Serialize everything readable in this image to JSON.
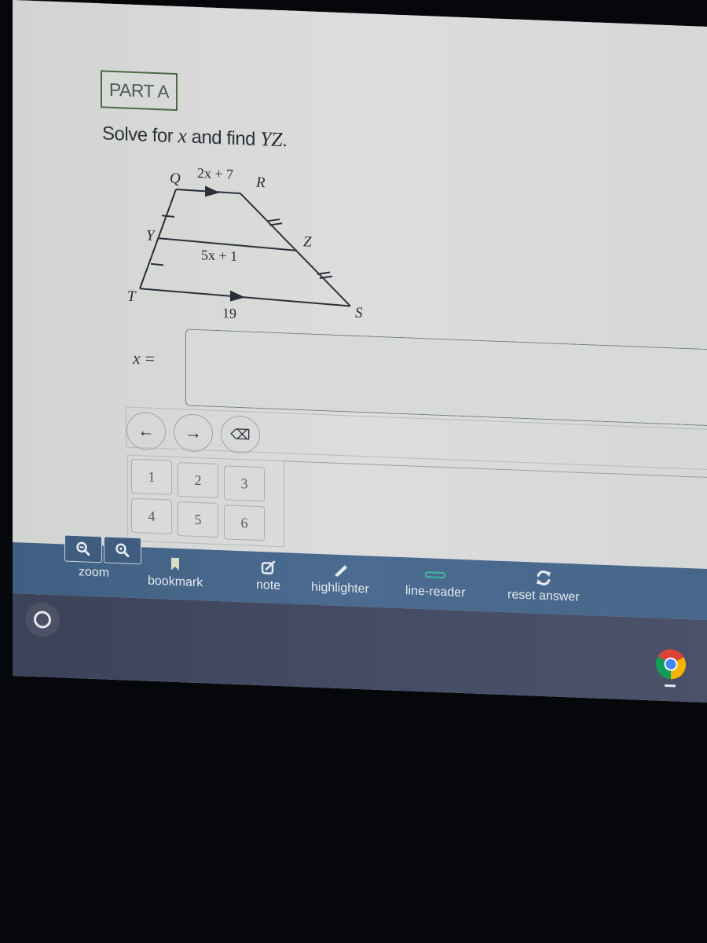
{
  "question": {
    "part_label": "PART A",
    "prompt_prefix": "Solve for ",
    "prompt_var": "x",
    "prompt_middle": " and find ",
    "prompt_segment": "YZ",
    "prompt_suffix": "."
  },
  "diagram": {
    "vertices": {
      "Q": "Q",
      "R": "R",
      "Y": "Y",
      "Z": "Z",
      "T": "T",
      "S": "S"
    },
    "top_base_label": "2x + 7",
    "midsegment_label": "5x + 1",
    "bottom_base_label": "19"
  },
  "answer": {
    "variable_label": "x",
    "equals": "=",
    "value": "",
    "placeholder": ""
  },
  "navigation": {
    "left_icon": "←",
    "right_icon": "→",
    "backspace_icon": "⌫"
  },
  "keypad": {
    "keys": [
      "1",
      "2",
      "3",
      "4",
      "5",
      "6"
    ]
  },
  "toolbar": {
    "zoom_label": "zoom",
    "bookmark_label": "bookmark",
    "note_label": "note",
    "highlighter_label": "highlighter",
    "line_reader_label": "line-reader",
    "reset_label": "reset answer"
  },
  "colors": {
    "toolbar_bg": "#46668a",
    "part_badge_border": "#4a6a44",
    "line_reader_accent": "#3fb8a0",
    "taskbar_bg": "#444b63"
  }
}
